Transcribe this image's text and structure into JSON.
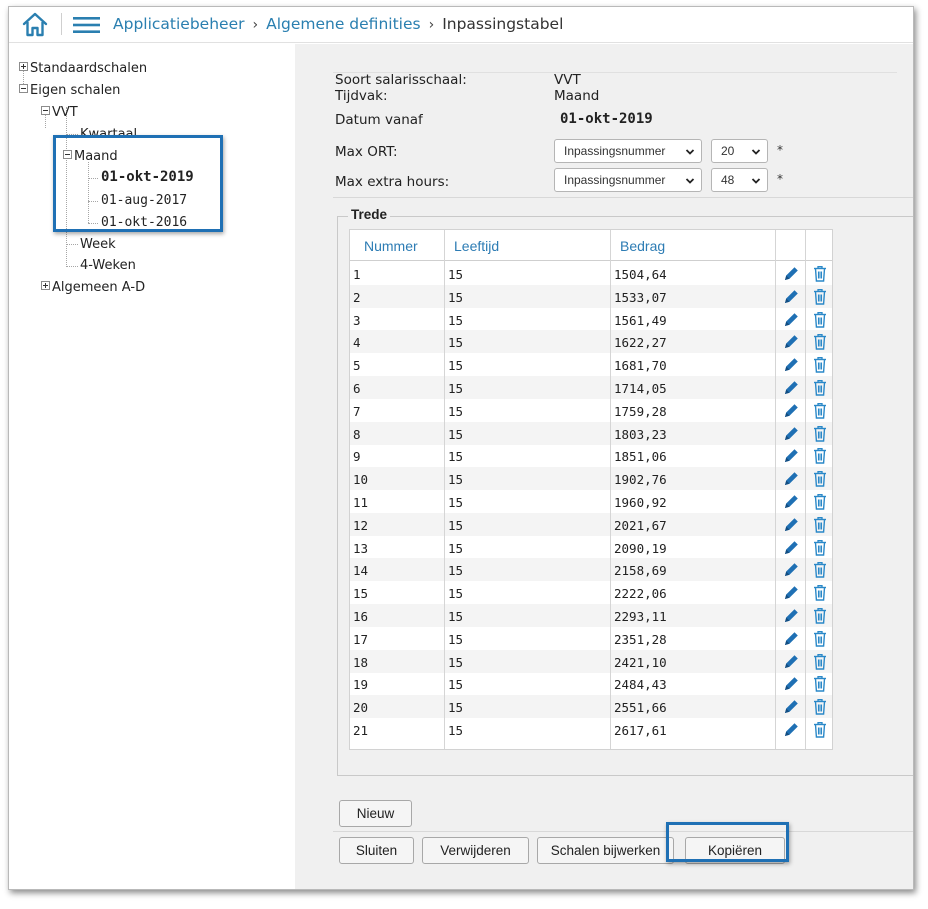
{
  "header": {
    "crumbs": [
      "Applicatiebeheer",
      "Algemene definities"
    ],
    "current": "Inpassingstabel",
    "separator": "›"
  },
  "tree": {
    "standaardschalen": "Standaardschalen",
    "eigen_schalen": "Eigen schalen",
    "vvt": "VVT",
    "kwartaal": "Kwartaal",
    "maand": "Maand",
    "date1": "01-okt-2019",
    "date2": "01-aug-2017",
    "date3": "01-okt-2016",
    "week": "Week",
    "vierweken": "4-Weken",
    "algemeen": "Algemeen A-D"
  },
  "form": {
    "soort_label": "Soort salarisschaal:",
    "soort_value": "VVT",
    "tijdvak_label": "Tijdvak:",
    "tijdvak_value": "Maand",
    "datum_label": "Datum vanaf",
    "datum_value": "01-okt-2019",
    "max_ort_label": "Max ORT:",
    "max_ort_type": "Inpassingsnummer",
    "max_ort_value": "20",
    "max_extra_label": "Max extra hours:",
    "max_extra_type": "Inpassingsnummer",
    "max_extra_value": "48",
    "required_mark": "*"
  },
  "trede": {
    "legend": "Trede",
    "columns": [
      "Nummer",
      "Leeftijd",
      "Bedrag"
    ],
    "rows": [
      [
        "1",
        "15",
        "1504,64"
      ],
      [
        "2",
        "15",
        "1533,07"
      ],
      [
        "3",
        "15",
        "1561,49"
      ],
      [
        "4",
        "15",
        "1622,27"
      ],
      [
        "5",
        "15",
        "1681,70"
      ],
      [
        "6",
        "15",
        "1714,05"
      ],
      [
        "7",
        "15",
        "1759,28"
      ],
      [
        "8",
        "15",
        "1803,23"
      ],
      [
        "9",
        "15",
        "1851,06"
      ],
      [
        "10",
        "15",
        "1902,76"
      ],
      [
        "11",
        "15",
        "1960,92"
      ],
      [
        "12",
        "15",
        "2021,67"
      ],
      [
        "13",
        "15",
        "2090,19"
      ],
      [
        "14",
        "15",
        "2158,69"
      ],
      [
        "15",
        "15",
        "2222,06"
      ],
      [
        "16",
        "15",
        "2293,11"
      ],
      [
        "17",
        "15",
        "2351,28"
      ],
      [
        "18",
        "15",
        "2421,10"
      ],
      [
        "19",
        "15",
        "2484,43"
      ],
      [
        "20",
        "15",
        "2551,66"
      ],
      [
        "21",
        "15",
        "2617,61"
      ]
    ]
  },
  "buttons": {
    "nieuw": "Nieuw",
    "sluiten": "Sluiten",
    "verwijderen": "Verwijderen",
    "schalen_bijwerken": "Schalen bijwerken",
    "kopieren": "Kopiëren"
  },
  "colors": {
    "accent": "#2a7fb0",
    "highlight": "#1f70b4",
    "panel_bg": "#f0f0f0"
  }
}
